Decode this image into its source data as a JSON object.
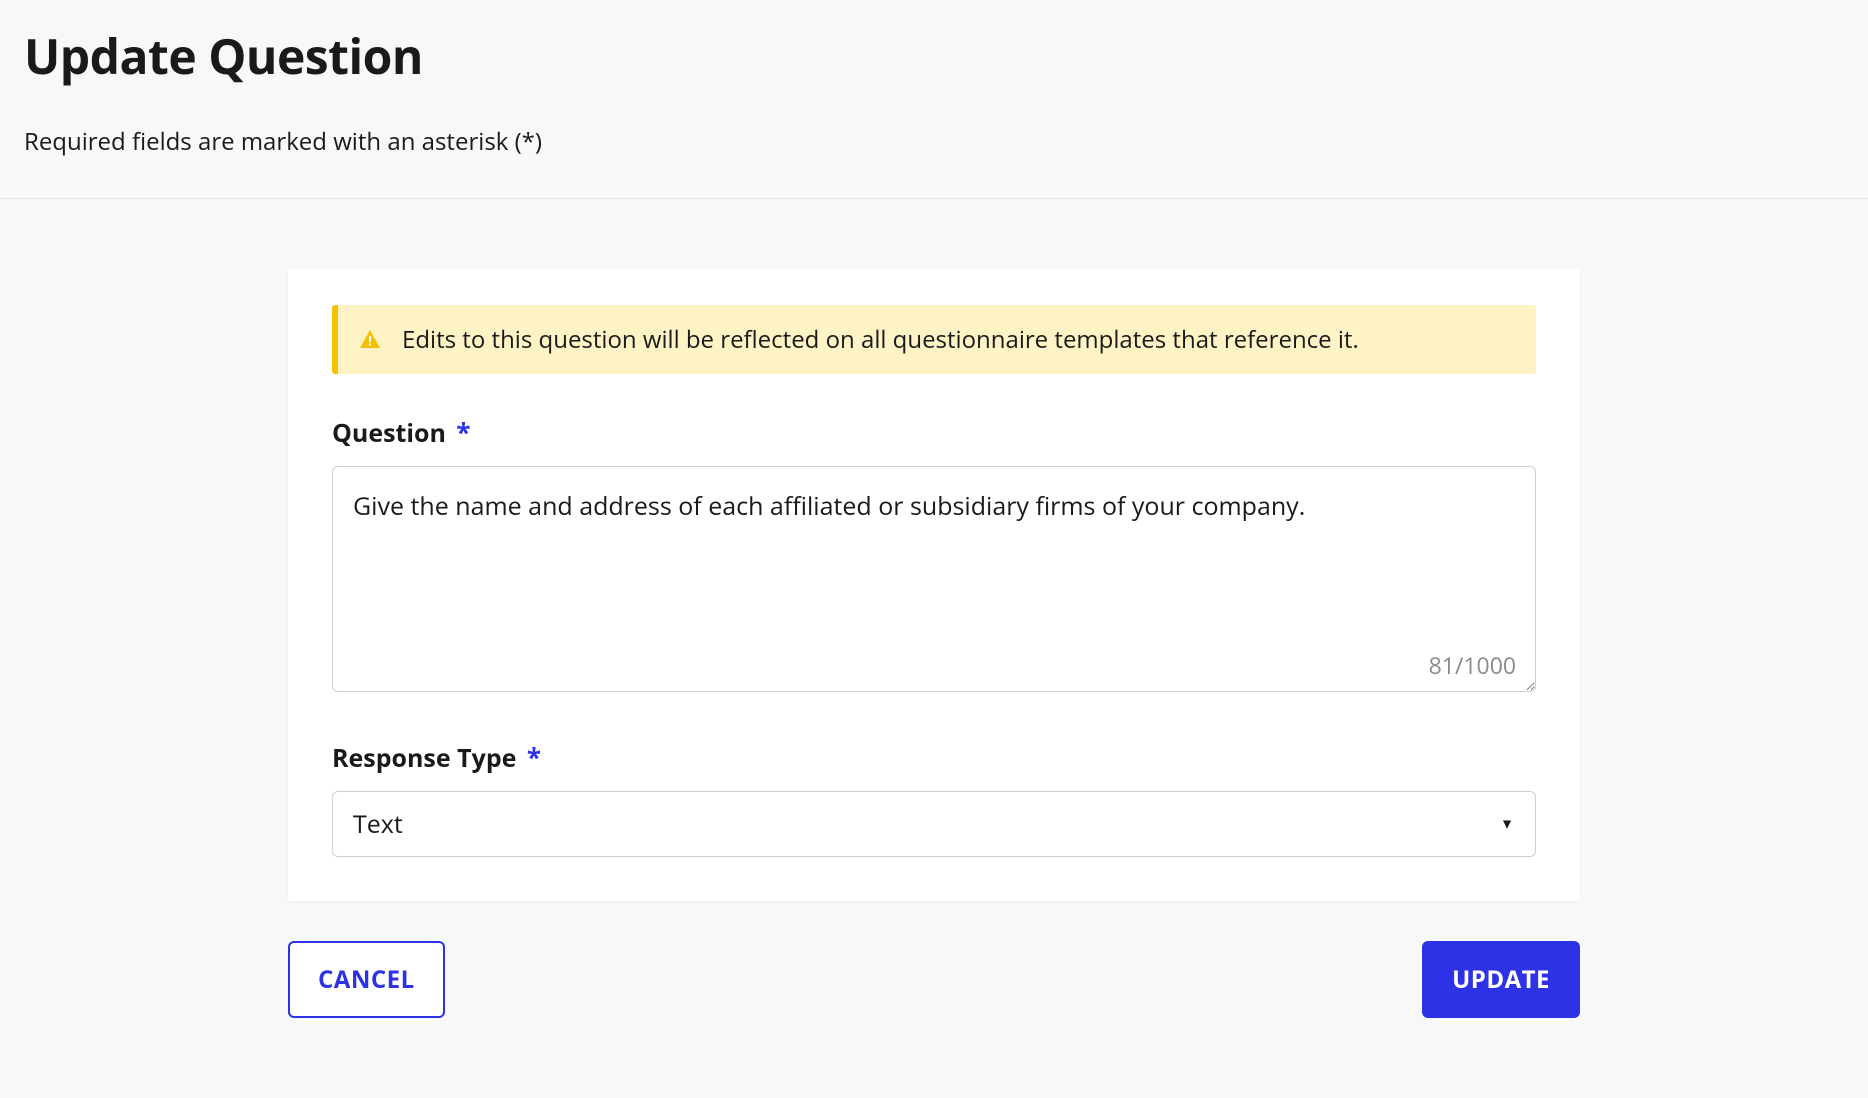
{
  "header": {
    "title": "Update Question",
    "required_note": "Required fields are marked with an asterisk (*)"
  },
  "alert": {
    "message": "Edits to this question will be reflected on all questionnaire templates that reference it."
  },
  "form": {
    "question_label": "Question",
    "question_value": "Give the name and address of each affiliated or subsidiary firms of your company.",
    "char_counter": "81/1000",
    "response_type_label": "Response Type",
    "response_type_value": "Text",
    "required_marker": "*"
  },
  "buttons": {
    "cancel": "CANCEL",
    "update": "UPDATE"
  }
}
